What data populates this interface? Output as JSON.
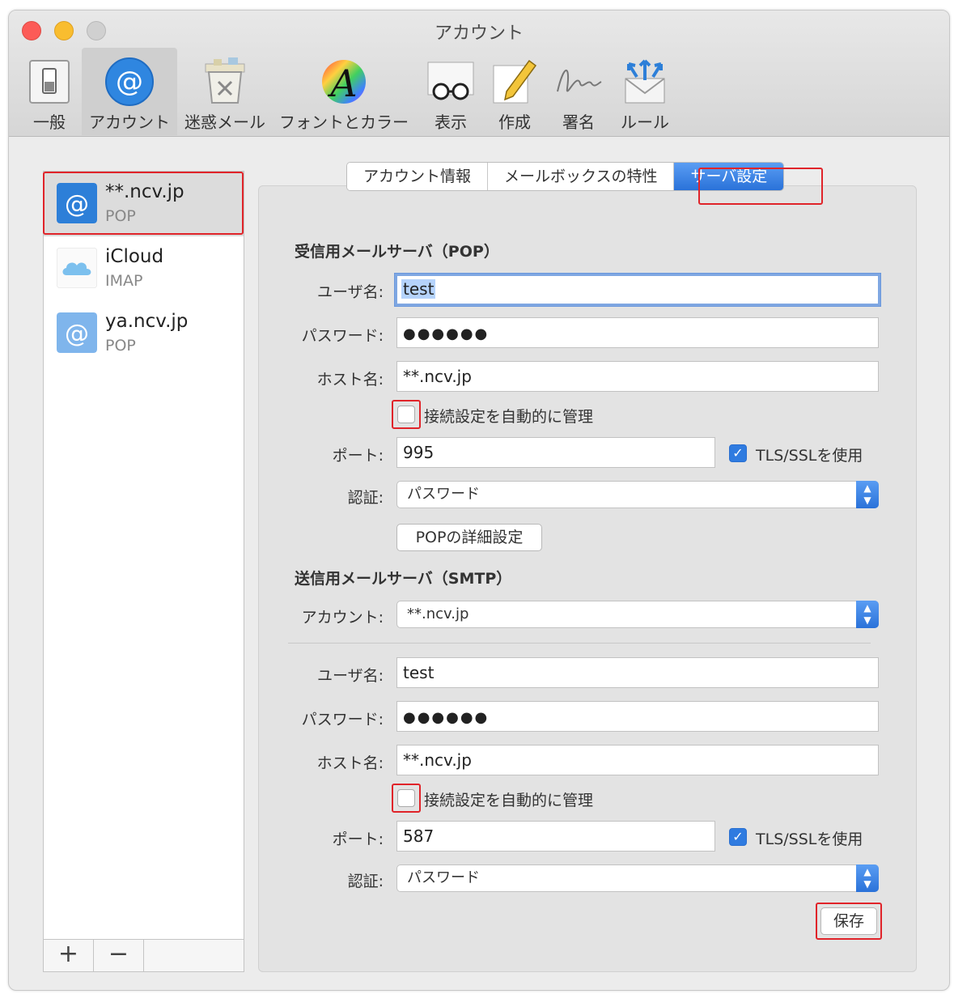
{
  "window": {
    "title": "アカウント"
  },
  "toolbar": {
    "items": [
      {
        "label": "一般",
        "icon": "switch-icon"
      },
      {
        "label": "アカウント",
        "icon": "at-sign-icon"
      },
      {
        "label": "迷惑メール",
        "icon": "trash-icon"
      },
      {
        "label": "フォントとカラー",
        "icon": "font-color-icon"
      },
      {
        "label": "表示",
        "icon": "glasses-icon"
      },
      {
        "label": "作成",
        "icon": "pencil-icon"
      },
      {
        "label": "署名",
        "icon": "signature-icon"
      },
      {
        "label": "ルール",
        "icon": "rules-icon"
      }
    ],
    "active_index": 1
  },
  "sidebar": {
    "accounts": [
      {
        "name": "**.ncv.jp",
        "type": "POP",
        "icon": "at-sign-icon"
      },
      {
        "name": "iCloud",
        "type": "IMAP",
        "icon": "cloud-icon"
      },
      {
        "name": "ya.ncv.jp",
        "type": "POP",
        "icon": "at-sign-icon"
      }
    ],
    "selected_index": 0,
    "add_label": "+",
    "remove_label": "−"
  },
  "tabs": {
    "items": [
      "アカウント情報",
      "メールボックスの特性",
      "サーバ設定"
    ],
    "active_index": 2
  },
  "incoming": {
    "title": "受信用メールサーバ（POP）",
    "username_label": "ユーザ名:",
    "username": "test",
    "password_label": "パスワード:",
    "password": "●●●●●●",
    "host_label": "ホスト名:",
    "host": "**.ncv.jp",
    "auto_manage_label": "接続設定を自動的に管理",
    "auto_manage": false,
    "port_label": "ポート:",
    "port": "995",
    "tls_label": "TLS/SSLを使用",
    "tls": true,
    "auth_label": "認証:",
    "auth": "パスワード",
    "advanced_button": "POPの詳細設定"
  },
  "outgoing": {
    "title": "送信用メールサーバ（SMTP）",
    "account_label": "アカウント:",
    "account": "**.ncv.jp",
    "username_label": "ユーザ名:",
    "username": "test",
    "password_label": "パスワード:",
    "password": "●●●●●●",
    "host_label": "ホスト名:",
    "host": "**.ncv.jp",
    "auto_manage_label": "接続設定を自動的に管理",
    "auto_manage": false,
    "port_label": "ポート:",
    "port": "587",
    "tls_label": "TLS/SSLを使用",
    "tls": true,
    "auth_label": "認証:",
    "auth": "パスワード"
  },
  "save_button": "保存",
  "colors": {
    "accent": "#2a72d9",
    "highlight": "#e0242a"
  }
}
